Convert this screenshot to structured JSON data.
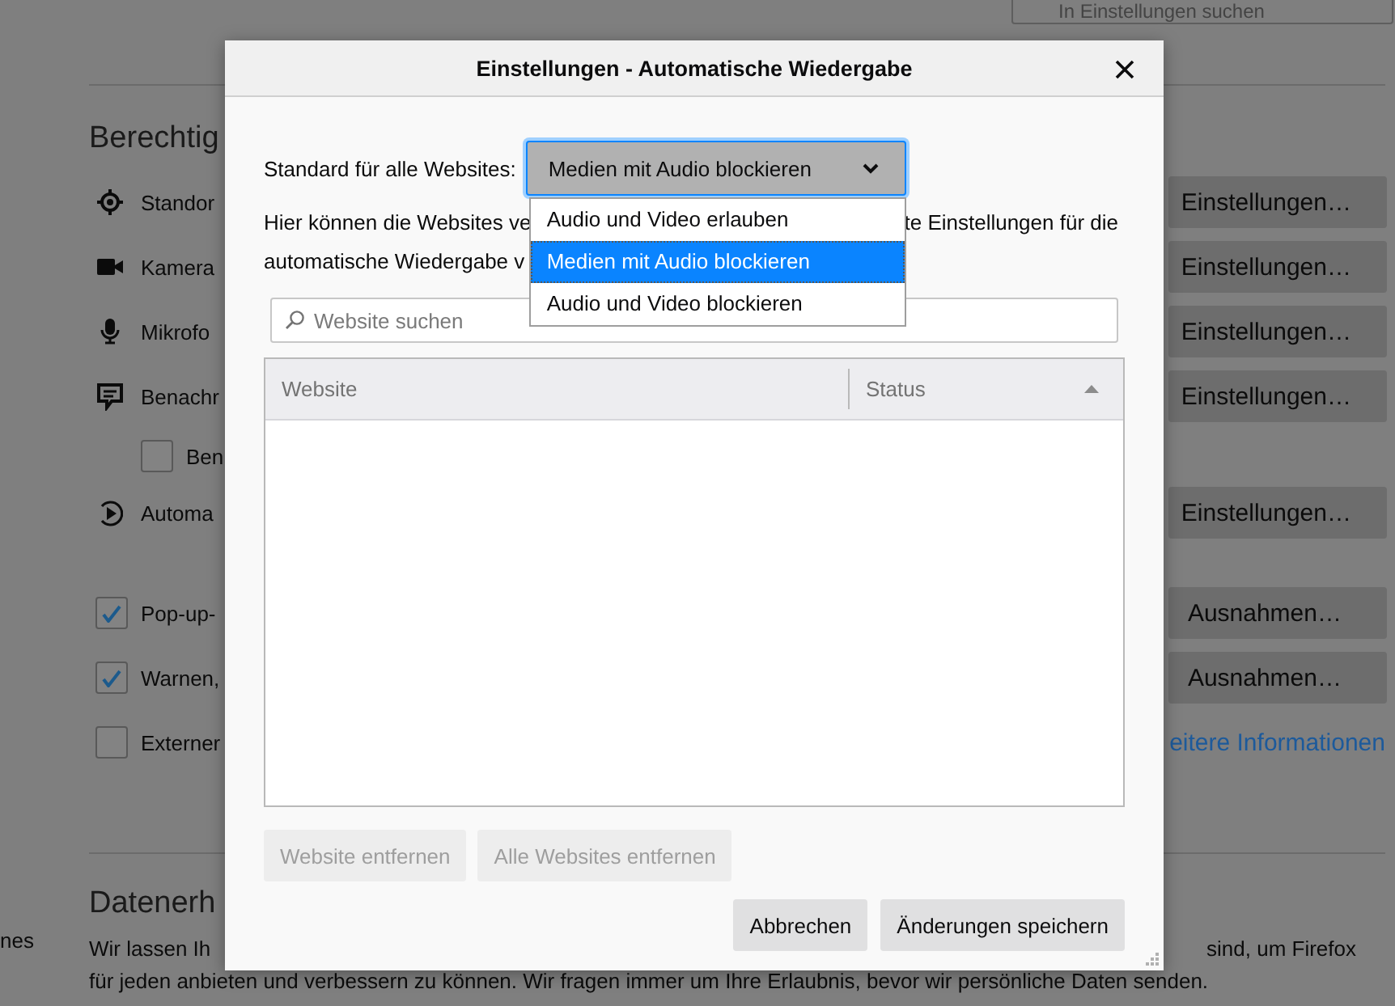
{
  "background_page": {
    "search": {
      "placeholder": "In Einstellungen suchen"
    },
    "sidebar_fragment": "nes",
    "permissions": {
      "heading": "Berechtig",
      "items": [
        {
          "kind": "permission",
          "label": "Standor",
          "button": "Einstellungen…"
        },
        {
          "kind": "permission",
          "label": "Kamera",
          "button": "Einstellungen…"
        },
        {
          "kind": "permission",
          "label": "Mikrofo",
          "button": "Einstellungen…"
        },
        {
          "kind": "permission",
          "label": "Benachr",
          "button": "Einstellungen…"
        },
        {
          "kind": "subcheckbox",
          "label": "Ben",
          "checked": false
        },
        {
          "kind": "permission",
          "label": "Automa",
          "button": "Einstellungen…"
        },
        {
          "kind": "checkbox",
          "label": "Pop-up-",
          "checked": true,
          "button": "Ausnahmen…"
        },
        {
          "kind": "checkbox",
          "label": "Warnen,",
          "checked": true,
          "button": "Ausnahmen…"
        },
        {
          "kind": "checkbox",
          "label": "Externer",
          "checked": false,
          "link": "eitere Informationen"
        }
      ]
    },
    "data_section": {
      "heading": "Datenerh",
      "lines": [
        {
          "left": "Wir lassen Ih",
          "right": "sind, um Firefox"
        },
        {
          "left": "für jeden anbieten und verbessern zu können. Wir fragen immer um Ihre Erlaubnis, bevor wir persönliche Daten senden."
        }
      ]
    }
  },
  "dialog": {
    "title": "Einstellungen - Automatische Wiedergabe",
    "default_label": "Standard für alle Websites:",
    "default_select": {
      "value": "Medien mit Audio blockieren",
      "expanded": true,
      "options": [
        {
          "label": "Audio und Video erlauben",
          "selected": false
        },
        {
          "label": "Medien mit Audio blockieren",
          "selected": true
        },
        {
          "label": "Audio und Video blockieren",
          "selected": false
        }
      ]
    },
    "description": {
      "line_1_left": "Hier können die Websites ve",
      "line_1_right": "te Einstellungen für die",
      "line_2": "automatische Wiedergabe v"
    },
    "search": {
      "placeholder": "Website suchen"
    },
    "table": {
      "columns": [
        {
          "label": "Website",
          "sorted": false
        },
        {
          "label": "Status",
          "sorted": true
        }
      ]
    },
    "actions": [
      {
        "label": "Website entfernen",
        "disabled": true
      },
      {
        "label": "Alle Websites entfernen",
        "disabled": true
      }
    ],
    "buttons": [
      {
        "label": "Abbrechen"
      },
      {
        "label": "Änderungen speichern"
      }
    ]
  }
}
